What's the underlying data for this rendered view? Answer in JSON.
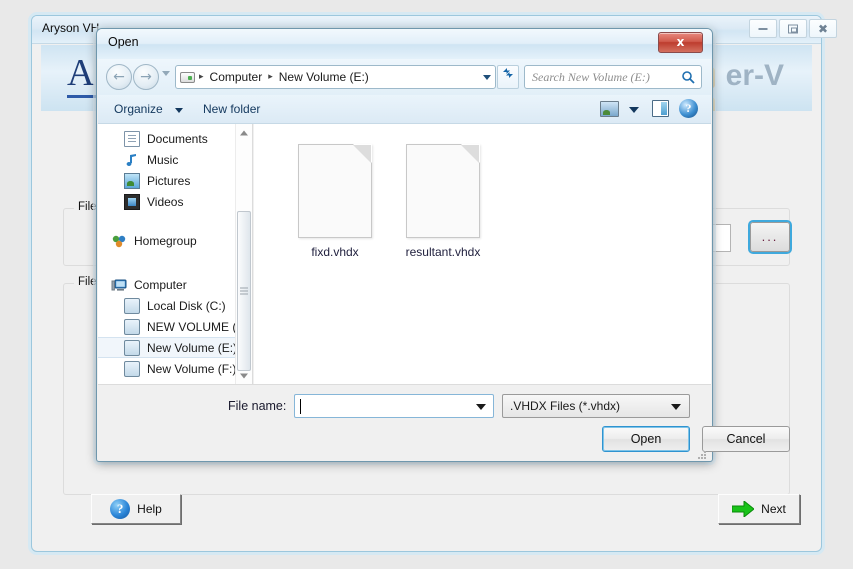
{
  "app_window": {
    "title": "Aryson VH",
    "banner_logo": "AR",
    "banner_title": "er-V",
    "minimize_label": "",
    "maximize_label": "",
    "close_label": "",
    "groups": {
      "file_path_label": "File P",
      "file_info_label": "File I"
    },
    "browse_button": "...",
    "footer": {
      "help_label": "Help",
      "help_icon": "?",
      "next_label": "Next"
    }
  },
  "dialog": {
    "title": "Open",
    "close_label": "x",
    "nav": {
      "back_icon": "←",
      "forward_icon": "→",
      "breadcrumbs": [
        "Computer",
        "New Volume (E:)"
      ],
      "separator": "▸",
      "refresh_icon": "↻"
    },
    "search": {
      "placeholder": "Search New Volume (E:)"
    },
    "command_bar": {
      "organize_label": "Organize",
      "new_folder_label": "New folder",
      "view_icon": "view-mode-icon",
      "preview_icon": "preview-pane-icon",
      "help_icon": "?"
    },
    "nav_pane": {
      "items": [
        {
          "label": "Documents",
          "icon": "document-icon",
          "type": "library",
          "selected": false
        },
        {
          "label": "Music",
          "icon": "music-icon",
          "type": "library",
          "selected": false
        },
        {
          "label": "Pictures",
          "icon": "pictures-icon",
          "type": "library",
          "selected": false
        },
        {
          "label": "Videos",
          "icon": "videos-icon",
          "type": "library",
          "selected": false
        },
        {
          "label": "Homegroup",
          "icon": "homegroup-icon",
          "type": "root",
          "selected": false
        },
        {
          "label": "Computer",
          "icon": "computer-icon",
          "type": "root",
          "selected": false
        },
        {
          "label": "Local Disk (C:)",
          "icon": "drive-icon",
          "type": "drive",
          "selected": false
        },
        {
          "label": "NEW VOLUME (D",
          "icon": "drive-icon",
          "type": "drive",
          "selected": false
        },
        {
          "label": "New Volume (E:)",
          "icon": "drive-icon",
          "type": "drive",
          "selected": true
        },
        {
          "label": "New Volume (F:)",
          "icon": "drive-icon",
          "type": "drive",
          "selected": false
        }
      ]
    },
    "files": [
      {
        "name": "fixd.vhdx",
        "icon": "generic-file-icon"
      },
      {
        "name": "resultant.vhdx",
        "icon": "generic-file-icon"
      }
    ],
    "footer": {
      "file_name_label": "File name:",
      "file_name_value": "",
      "filter_value": ".VHDX Files (*.vhdx)",
      "open_label": "Open",
      "cancel_label": "Cancel"
    }
  },
  "colors": {
    "accent_blue": "#2f93d0",
    "close_red": "#bd3c2e",
    "next_green": "#19c319",
    "logo_blue": "#1f3e78"
  }
}
